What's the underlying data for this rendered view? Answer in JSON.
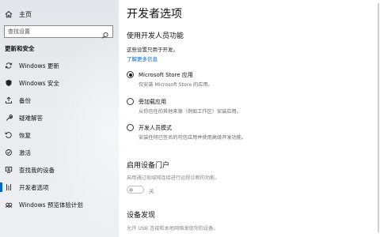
{
  "sidebar": {
    "home_label": "主页",
    "search_placeholder": "查找设置",
    "section_title": "更新和安全",
    "items": [
      {
        "label": "Windows 更新",
        "icon": "sync-icon"
      },
      {
        "label": "Windows 安全",
        "icon": "shield-icon"
      },
      {
        "label": "备份",
        "icon": "backup-icon"
      },
      {
        "label": "疑难解答",
        "icon": "wrench-icon"
      },
      {
        "label": "恢复",
        "icon": "recovery-icon"
      },
      {
        "label": "激活",
        "icon": "activation-icon"
      },
      {
        "label": "查找我的设备",
        "icon": "find-device-icon"
      },
      {
        "label": "开发者选项",
        "icon": "developer-icon"
      },
      {
        "label": "Windows 预览体验计划",
        "icon": "insider-icon"
      }
    ]
  },
  "main": {
    "title": "开发者选项",
    "dev_features_heading": "使用开发人员功能",
    "dev_features_note": "这些设置只用于开发。",
    "learn_more_link": "了解更多信息",
    "options": [
      {
        "label": "Microsoft Store 应用",
        "desc": "仅安装 Microsoft Store 的应用。",
        "checked": true
      },
      {
        "label": "旁加载应用",
        "desc": "从你信任的其他来源（例如工作区）安装应用。",
        "checked": false
      },
      {
        "label": "开发人员模式",
        "desc": "安装任何已签名的可信应用并使用高级开发功能。",
        "checked": false
      }
    ],
    "portal_heading": "启用设备门户",
    "portal_desc": "启用通过局域网连接进行远程诊断的功能。",
    "portal_toggle_label": "关",
    "discovery_heading": "设备发现",
    "discovery_desc": "允许 USB 连接和本地网络发现你的设备。"
  },
  "colors": {
    "accent": "#0067c0"
  }
}
